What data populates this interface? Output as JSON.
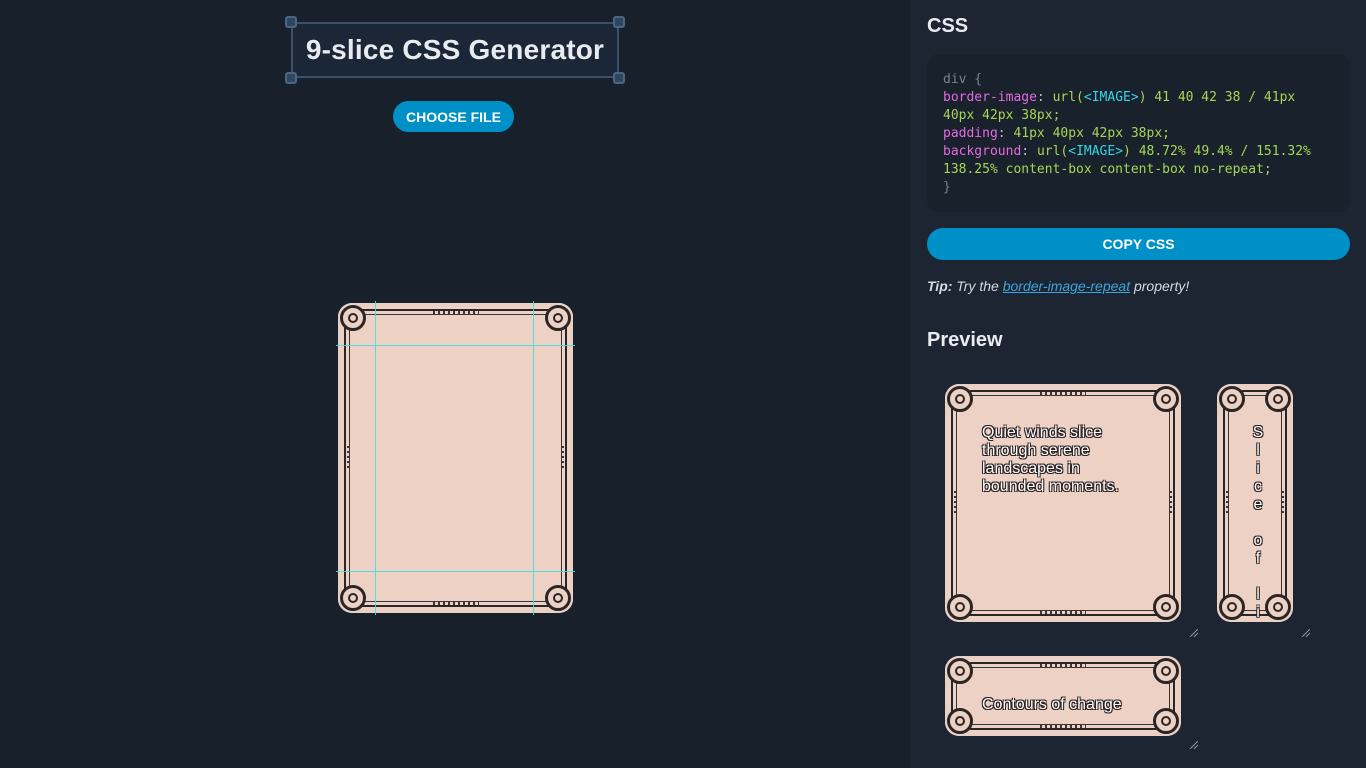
{
  "app": {
    "title": "9-slice CSS Generator",
    "choose_file_label": "CHOOSE FILE"
  },
  "css_panel": {
    "heading": "CSS",
    "code": {
      "selector_open": "div {",
      "border_image_prop": "border-image",
      "border_image_fn": "url(",
      "border_image_img": "<IMAGE>",
      "border_image_rest_1": ") 41 40 42 38 / 41px",
      "border_image_rest_2": "40px 42px 38px;",
      "padding_prop": "padding",
      "padding_val": "41px 40px 42px 38px;",
      "background_prop": "background",
      "background_fn": "url(",
      "background_img": "<IMAGE>",
      "background_rest_1": ") 48.72% 49.4% / 151.32%",
      "background_rest_2": "138.25% content-box content-box no-repeat;",
      "selector_close": "}"
    },
    "copy_label": "COPY CSS",
    "tip": {
      "bold": "Tip:",
      "before": "Try the",
      "link": "border-image-repeat",
      "after": "property!"
    }
  },
  "preview": {
    "heading": "Preview",
    "box1_text": "Quiet winds slice through serene landscapes in bounded moments.",
    "box2_text": "Slice of life",
    "box3_text": "Contours of change"
  },
  "colors": {
    "accent": "#0090c8",
    "guide": "#3ee0e0",
    "card": "#ecd1c4"
  }
}
